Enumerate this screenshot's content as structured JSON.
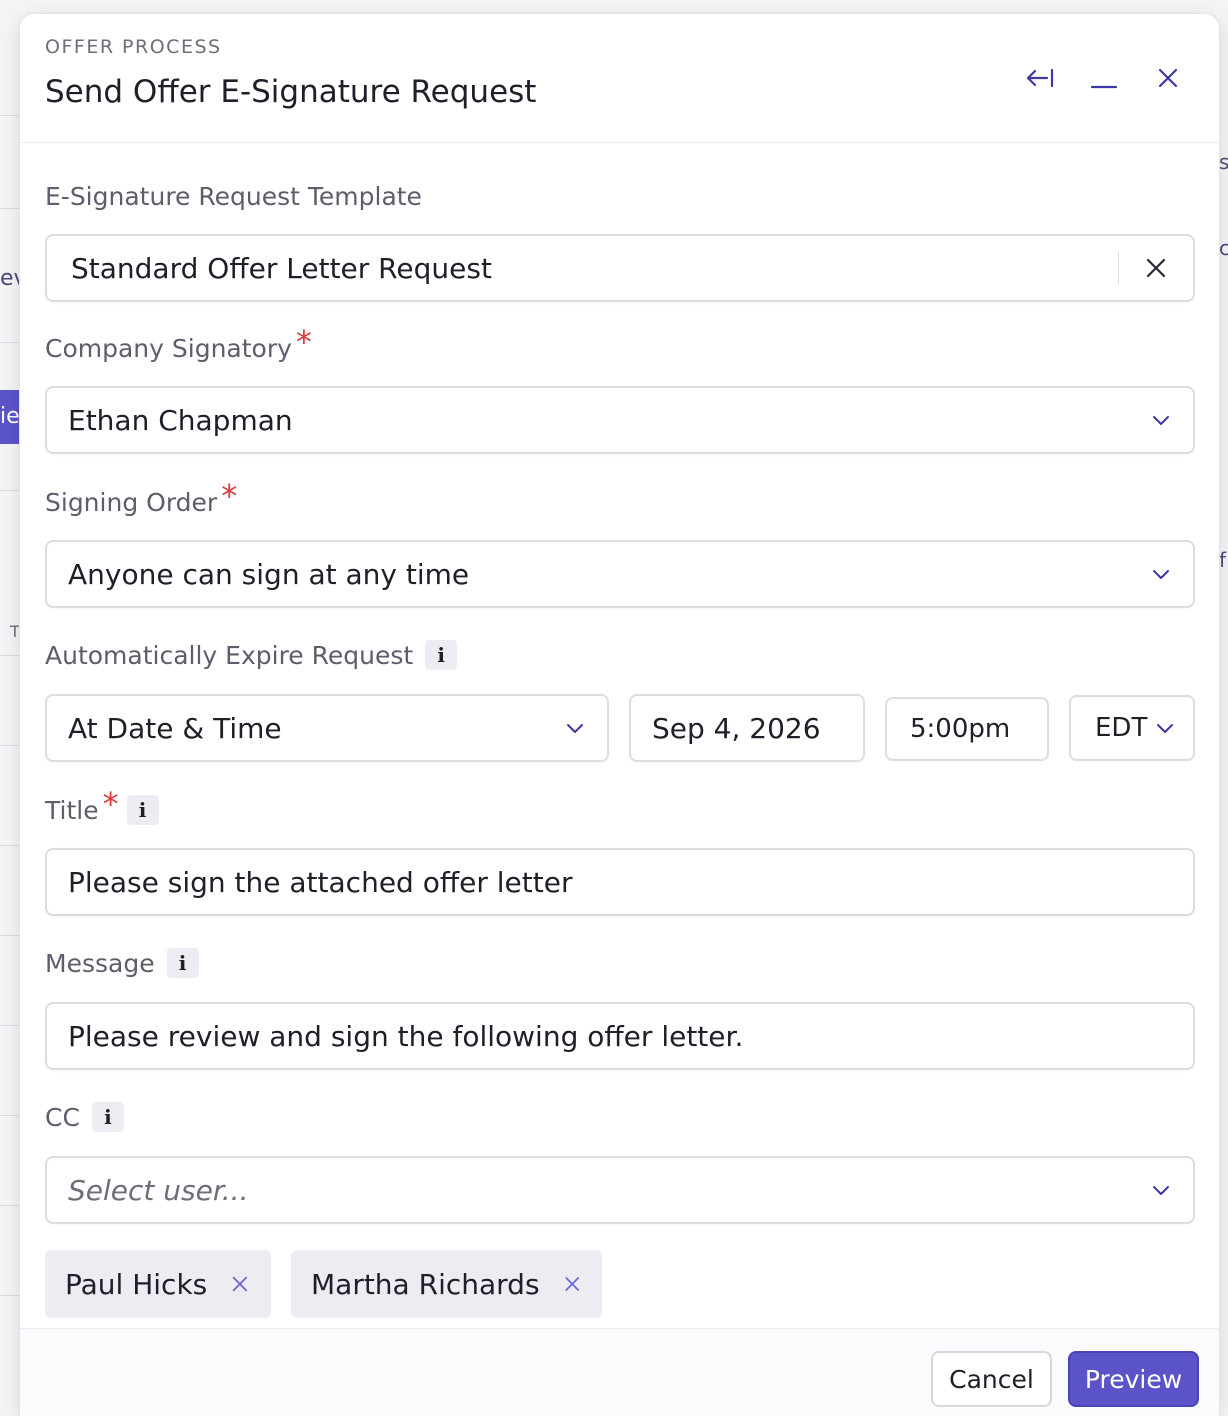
{
  "header": {
    "eyebrow": "OFFER PROCESS",
    "title": "Send Offer E-Signature Request",
    "icons": [
      "collapse-left-icon",
      "minimize-icon",
      "close-icon"
    ]
  },
  "fields": {
    "template": {
      "label": "E-Signature Request Template",
      "value": "Standard Offer Letter Request"
    },
    "signatory": {
      "label": "Company Signatory",
      "value": "Ethan Chapman"
    },
    "signing_order": {
      "label": "Signing Order",
      "value": "Anyone can sign at any time"
    },
    "expire": {
      "label": "Automatically Expire Request",
      "mode": "At Date & Time",
      "date": "Sep 4, 2026",
      "time": "5:00pm",
      "timezone": "EDT"
    },
    "title": {
      "label": "Title",
      "value": "Please sign the attached offer letter"
    },
    "message": {
      "label": "Message",
      "value": "Please review and sign the following offer letter."
    },
    "cc": {
      "label": "CC",
      "placeholder": "Select user...",
      "selected": [
        "Paul Hicks",
        "Martha Richards"
      ]
    }
  },
  "footer": {
    "cancel_label": "Cancel",
    "preview_label": "Preview"
  },
  "background": {
    "fragments": [
      "ev",
      "ie",
      "T",
      "s",
      "c",
      "f"
    ]
  },
  "colors": {
    "accent": "#5b54c8",
    "required": "#e0393e",
    "icon": "#3d37a8"
  }
}
